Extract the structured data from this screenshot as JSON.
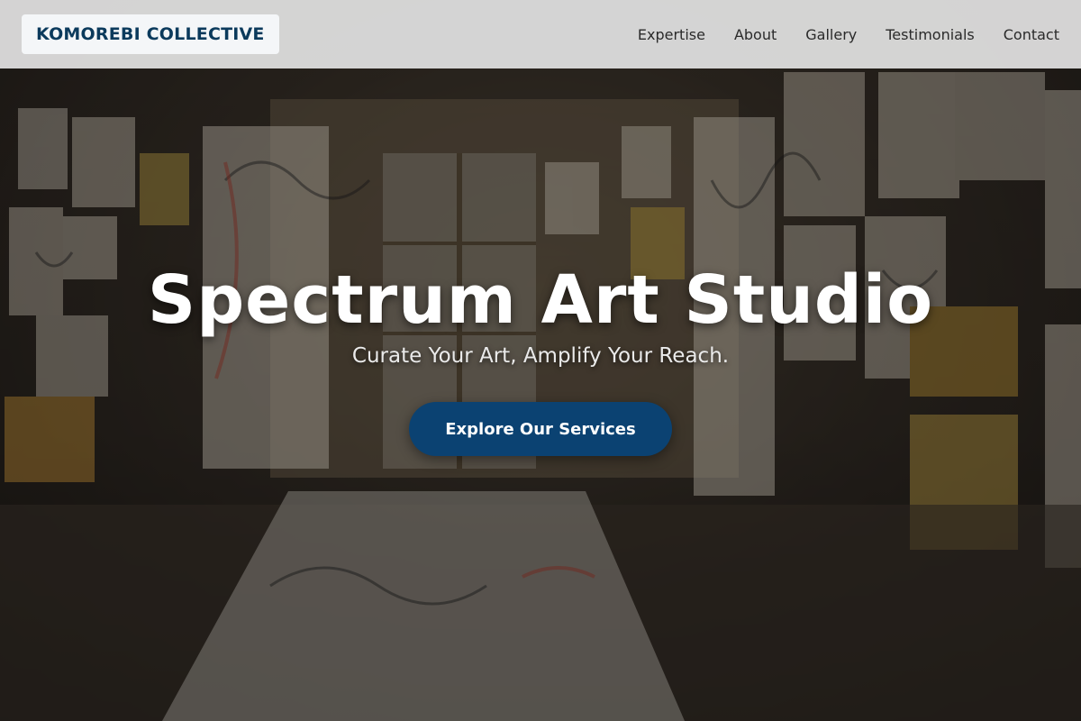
{
  "header": {
    "brand": "KOMOREBI COLLECTIVE",
    "nav": [
      {
        "label": "Expertise"
      },
      {
        "label": "About"
      },
      {
        "label": "Gallery"
      },
      {
        "label": "Testimonials"
      },
      {
        "label": "Contact"
      }
    ]
  },
  "hero": {
    "title": "Spectrum Art Studio",
    "subtitle": "Curate Your Art, Amplify Your Reach.",
    "cta_label": "Explore Our Services",
    "background_image": "art-studio-photo"
  },
  "colors": {
    "brand_text": "#0b3a5c",
    "cta_bg": "#0b4272",
    "header_bg": "#e2e2e2"
  }
}
